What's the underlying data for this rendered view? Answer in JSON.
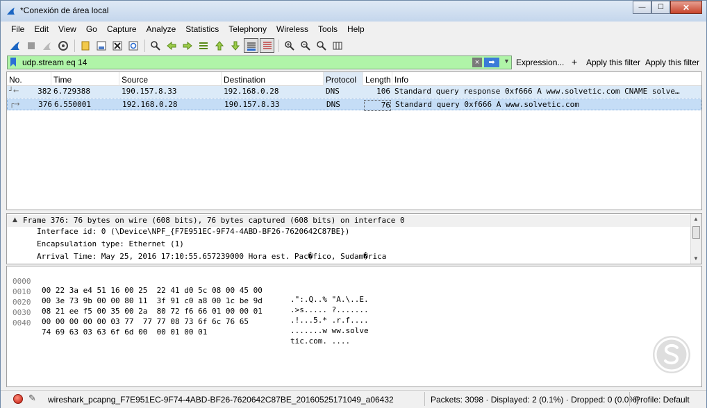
{
  "window": {
    "title": "*Conexión de área local",
    "controls": {
      "minimize": "—",
      "maximize": "☐",
      "close": "✕"
    }
  },
  "menu": [
    "File",
    "Edit",
    "View",
    "Go",
    "Capture",
    "Analyze",
    "Statistics",
    "Telephony",
    "Wireless",
    "Tools",
    "Help"
  ],
  "filter": {
    "value": "udp.stream eq 14",
    "clear_icon": "×",
    "apply_icon": "➡",
    "dropdown_icon": "▼",
    "expression_label": "Expression...",
    "plus_label": "+",
    "apply_filter_1": "Apply this filter",
    "apply_filter_2": "Apply this filter"
  },
  "packet_list": {
    "columns": [
      "No.",
      "Time",
      "Source",
      "Destination",
      "Protocol",
      "Length",
      "Info"
    ],
    "rows": [
      {
        "no": "382",
        "time": "6.729388",
        "source": "190.157.8.33",
        "destination": "192.168.0.28",
        "protocol": "DNS",
        "length": "106",
        "info": "Standard query response 0xf666 A www.solvetic.com CNAME solve…"
      },
      {
        "no": "376",
        "time": "6.550001",
        "source": "192.168.0.28",
        "destination": "190.157.8.33",
        "protocol": "DNS",
        "length": "76",
        "info": "Standard query 0xf666 A www.solvetic.com"
      }
    ]
  },
  "details": {
    "frame": "Frame 376: 76 bytes on wire (608 bits), 76 bytes captured (608 bits) on interface 0",
    "lines": [
      "Interface id: 0 (\\Device\\NPF_{F7E951EC-9F74-4ABD-BF26-7620642C87BE})",
      "Encapsulation type: Ethernet (1)",
      "Arrival Time: May 25, 2016 17:10:55.657239000 Hora est. Pac�fico, Sudam�rica"
    ]
  },
  "bytes": [
    {
      "offset": "0000",
      "hex": "00 22 3a e4 51 16 00 25  22 41 d0 5c 08 00 45 00",
      "ascii": ".\":.Q..% \"A.\\..E."
    },
    {
      "offset": "0010",
      "hex": "00 3e 73 9b 00 00 80 11  3f 91 c0 a8 00 1c be 9d",
      "ascii": ".>s..... ?......."
    },
    {
      "offset": "0020",
      "hex": "08 21 ee f5 00 35 00 2a  80 72 f6 66 01 00 00 01",
      "ascii": ".!...5.* .r.f...."
    },
    {
      "offset": "0030",
      "hex": "00 00 00 00 00 03 77  77 77 08 73 6f 6c 76 65",
      "ascii": ".......w ww.solve"
    },
    {
      "offset": "0040",
      "hex": "74 69 63 03 63 6f 6d 00  00 01 00 01",
      "ascii": "tic.com. ...."
    }
  ],
  "status": {
    "file": "wireshark_pcapng_F7E951EC-9F74-4ABD-BF26-7620642C87BE_20160525171049_a06432",
    "packets": "Packets: 3098 · Displayed: 2 (0.1%) · Dropped: 0 (0.0%)",
    "profile": "Profile: Default"
  },
  "colors": {
    "filter_bg": "#b0f4a8",
    "row_selected": "#c5ddf6",
    "row_related": "#dbeaf8"
  },
  "icons": [
    "shark-fin-icon",
    "stop-icon",
    "restart-icon",
    "options-icon",
    "open-icon",
    "save-icon",
    "close-file-icon",
    "reload-icon",
    "find-icon",
    "back-icon",
    "forward-icon",
    "goto-icon",
    "first-icon",
    "last-icon",
    "autoscroll-icon",
    "colorize-icon",
    "zoom-in-icon",
    "zoom-out-icon",
    "normal-size-icon",
    "resize-columns-icon"
  ]
}
